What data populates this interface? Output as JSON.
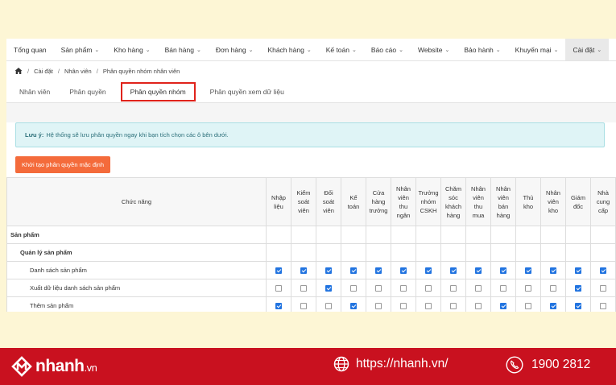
{
  "navbar": {
    "items": [
      {
        "label": "Tổng quan",
        "chevron": false
      },
      {
        "label": "Sản phẩm",
        "chevron": true
      },
      {
        "label": "Kho hàng",
        "chevron": true
      },
      {
        "label": "Bán hàng",
        "chevron": true
      },
      {
        "label": "Đơn hàng",
        "chevron": true
      },
      {
        "label": "Khách hàng",
        "chevron": true
      },
      {
        "label": "Kế toán",
        "chevron": true
      },
      {
        "label": "Báo cáo",
        "chevron": true
      },
      {
        "label": "Website",
        "chevron": true
      },
      {
        "label": "Bảo hành",
        "chevron": true
      },
      {
        "label": "Khuyến mại",
        "chevron": true
      },
      {
        "label": "Cài đặt",
        "chevron": true,
        "active": true
      }
    ]
  },
  "breadcrumb": [
    "Cài đặt",
    "Nhân viên",
    "Phân quyền nhóm nhân viên"
  ],
  "subtabs": [
    {
      "label": "Nhân viên"
    },
    {
      "label": "Phân quyền"
    },
    {
      "label": "Phân quyền nhóm",
      "active": true
    },
    {
      "label": "Phân quyền xem dữ liệu"
    }
  ],
  "notice": {
    "bold": "Lưu ý:",
    "text": "Hệ thống sẽ lưu phân quyền ngay khi bạn tích chọn các ô bên dưới."
  },
  "init_button": "Khởi tạo phân quyền mặc định",
  "table": {
    "function_header": "Chức năng",
    "roles": [
      [
        "Nhập",
        "liệu"
      ],
      [
        "Kiểm",
        "soát",
        "viên"
      ],
      [
        "Đối",
        "soát",
        "viên"
      ],
      [
        "Kế",
        "toán"
      ],
      [
        "Cửa",
        "hàng",
        "trưởng"
      ],
      [
        "Nhân",
        "viên",
        "thu",
        "ngân"
      ],
      [
        "Trưởng",
        "nhóm",
        "CSKH"
      ],
      [
        "Chăm",
        "sóc",
        "khách",
        "hàng"
      ],
      [
        "Nhân",
        "viên",
        "thu",
        "mua"
      ],
      [
        "Nhân",
        "viên",
        "bán",
        "hàng"
      ],
      [
        "Thủ",
        "kho"
      ],
      [
        "Nhân",
        "viên",
        "kho"
      ],
      [
        "Giám",
        "đốc"
      ],
      [
        "Nhà",
        "cung",
        "cấp"
      ]
    ],
    "rows": [
      {
        "label": "Sản phẩm",
        "level": 0,
        "checks": null
      },
      {
        "label": "Quản lý sản phẩm",
        "level": 1,
        "checks": null
      },
      {
        "label": "Danh sách sản phẩm",
        "level": 2,
        "checks": [
          1,
          1,
          1,
          1,
          1,
          1,
          1,
          1,
          1,
          1,
          1,
          1,
          1,
          1
        ]
      },
      {
        "label": "Xuất dữ liệu danh sách sản phẩm",
        "level": 2,
        "checks": [
          0,
          0,
          1,
          0,
          0,
          0,
          0,
          0,
          0,
          0,
          0,
          0,
          1,
          0
        ]
      },
      {
        "label": "Thêm sản phẩm",
        "level": 2,
        "checks": [
          1,
          0,
          0,
          1,
          0,
          0,
          0,
          0,
          0,
          1,
          0,
          1,
          1,
          0
        ]
      }
    ]
  },
  "footer": {
    "brand": "nhanh",
    "brand_suffix": ".vn",
    "website": "https://nhanh.vn/",
    "phone": "1900 2812",
    "colors": {
      "footer_bg": "#c9111f",
      "accent": "#f46b3b",
      "checkbox": "#2274e0"
    }
  }
}
